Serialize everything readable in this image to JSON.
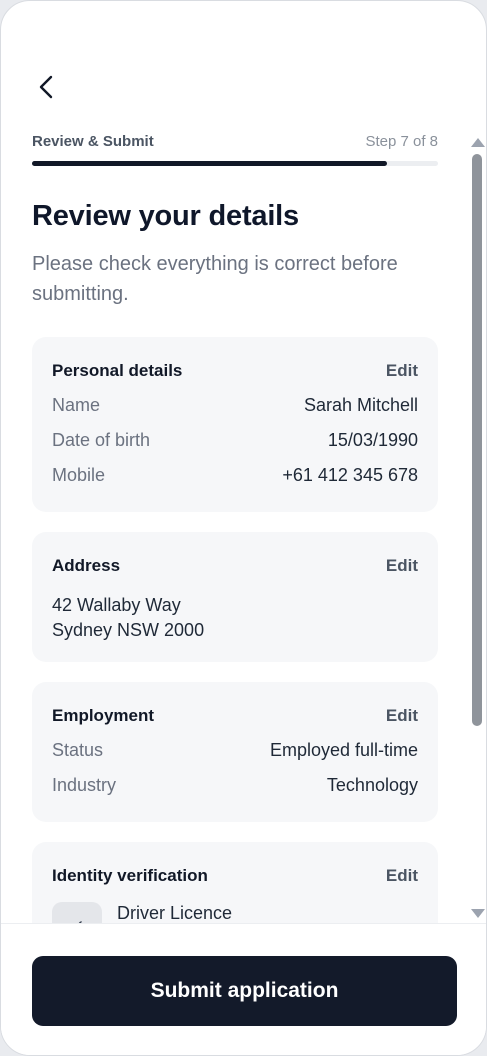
{
  "header": {
    "back_icon": "chevron-left-icon",
    "progress_title": "Review & Submit",
    "progress_step": "Step 7 of 8",
    "progress_fraction": 0.875
  },
  "title": "Review your details",
  "subtitle": "Please check everything is correct before submitting.",
  "sections": {
    "personal": {
      "title": "Personal details",
      "edit": "Edit",
      "rows": [
        {
          "label": "Name",
          "value": "Sarah Mitchell"
        },
        {
          "label": "Date of birth",
          "value": "15/03/1990"
        },
        {
          "label": "Mobile",
          "value": "+61 412 345 678"
        }
      ]
    },
    "address": {
      "title": "Address",
      "edit": "Edit",
      "line1": "42 Wallaby Way",
      "line2": "Sydney NSW 2000"
    },
    "employment": {
      "title": "Employment",
      "edit": "Edit",
      "rows": [
        {
          "label": "Status",
          "value": "Employed full-time"
        },
        {
          "label": "Industry",
          "value": "Technology"
        }
      ]
    },
    "identity": {
      "title": "Identity verification",
      "edit": "Edit",
      "document": "Driver Licence",
      "thumb_icon": "check-icon"
    }
  },
  "footer": {
    "submit_label": "Submit application"
  },
  "colors": {
    "primary": "#131a2a",
    "card_bg": "#f6f7f9",
    "muted_text": "#6b7280"
  }
}
